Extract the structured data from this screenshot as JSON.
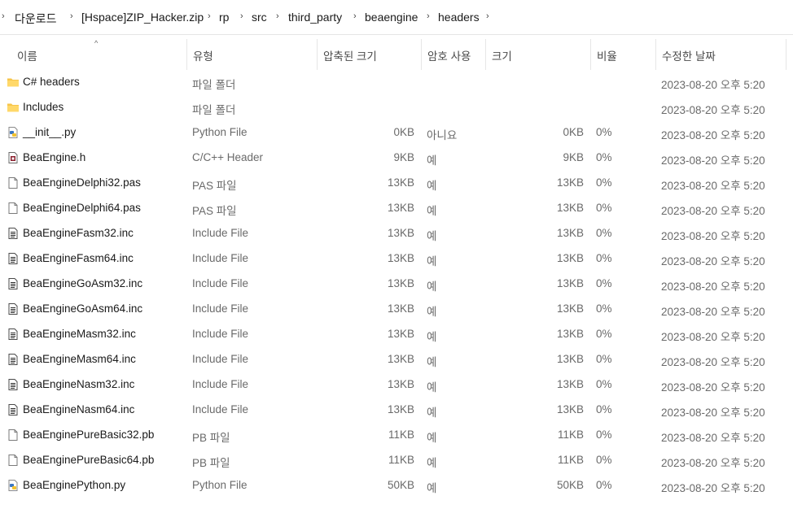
{
  "breadcrumb": {
    "lead_arrow": "›",
    "items": [
      "다운로드",
      "[Hspace]ZIP_Hacker.zip",
      "rp",
      "src",
      "third_party",
      "beaengine",
      "headers"
    ],
    "trail_arrow": "›"
  },
  "columns": {
    "name": "이름",
    "type": "유형",
    "compressed_size": "압축된 크기",
    "password": "암호 사용",
    "size": "크기",
    "ratio": "비율",
    "modified": "수정한 날짜",
    "sort_indicator": "^"
  },
  "rows": [
    {
      "icon": "folder-icon",
      "name": "C# headers",
      "type": "파일 폴더",
      "csize": "",
      "pw": "",
      "size": "",
      "ratio": "",
      "date": "2023-08-20 오후 5:20"
    },
    {
      "icon": "folder-icon",
      "name": "Includes",
      "type": "파일 폴더",
      "csize": "",
      "pw": "",
      "size": "",
      "ratio": "",
      "date": "2023-08-20 오후 5:20"
    },
    {
      "icon": "python-file-icon",
      "name": "__init__.py",
      "type": "Python File",
      "csize": "0KB",
      "pw": "아니요",
      "size": "0KB",
      "ratio": "0%",
      "date": "2023-08-20 오후 5:20"
    },
    {
      "icon": "header-file-icon",
      "name": "BeaEngine.h",
      "type": "C/C++ Header",
      "csize": "9KB",
      "pw": "예",
      "size": "9KB",
      "ratio": "0%",
      "date": "2023-08-20 오후 5:20"
    },
    {
      "icon": "blank-file-icon",
      "name": "BeaEngineDelphi32.pas",
      "type": "PAS 파일",
      "csize": "13KB",
      "pw": "예",
      "size": "13KB",
      "ratio": "0%",
      "date": "2023-08-20 오후 5:20"
    },
    {
      "icon": "blank-file-icon",
      "name": "BeaEngineDelphi64.pas",
      "type": "PAS 파일",
      "csize": "13KB",
      "pw": "예",
      "size": "13KB",
      "ratio": "0%",
      "date": "2023-08-20 오후 5:20"
    },
    {
      "icon": "text-file-icon",
      "name": "BeaEngineFasm32.inc",
      "type": "Include File",
      "csize": "13KB",
      "pw": "예",
      "size": "13KB",
      "ratio": "0%",
      "date": "2023-08-20 오후 5:20"
    },
    {
      "icon": "text-file-icon",
      "name": "BeaEngineFasm64.inc",
      "type": "Include File",
      "csize": "13KB",
      "pw": "예",
      "size": "13KB",
      "ratio": "0%",
      "date": "2023-08-20 오후 5:20"
    },
    {
      "icon": "text-file-icon",
      "name": "BeaEngineGoAsm32.inc",
      "type": "Include File",
      "csize": "13KB",
      "pw": "예",
      "size": "13KB",
      "ratio": "0%",
      "date": "2023-08-20 오후 5:20"
    },
    {
      "icon": "text-file-icon",
      "name": "BeaEngineGoAsm64.inc",
      "type": "Include File",
      "csize": "13KB",
      "pw": "예",
      "size": "13KB",
      "ratio": "0%",
      "date": "2023-08-20 오후 5:20"
    },
    {
      "icon": "text-file-icon",
      "name": "BeaEngineMasm32.inc",
      "type": "Include File",
      "csize": "13KB",
      "pw": "예",
      "size": "13KB",
      "ratio": "0%",
      "date": "2023-08-20 오후 5:20"
    },
    {
      "icon": "text-file-icon",
      "name": "BeaEngineMasm64.inc",
      "type": "Include File",
      "csize": "13KB",
      "pw": "예",
      "size": "13KB",
      "ratio": "0%",
      "date": "2023-08-20 오후 5:20"
    },
    {
      "icon": "text-file-icon",
      "name": "BeaEngineNasm32.inc",
      "type": "Include File",
      "csize": "13KB",
      "pw": "예",
      "size": "13KB",
      "ratio": "0%",
      "date": "2023-08-20 오후 5:20"
    },
    {
      "icon": "text-file-icon",
      "name": "BeaEngineNasm64.inc",
      "type": "Include File",
      "csize": "13KB",
      "pw": "예",
      "size": "13KB",
      "ratio": "0%",
      "date": "2023-08-20 오후 5:20"
    },
    {
      "icon": "blank-file-icon",
      "name": "BeaEnginePureBasic32.pb",
      "type": "PB 파일",
      "csize": "11KB",
      "pw": "예",
      "size": "11KB",
      "ratio": "0%",
      "date": "2023-08-20 오후 5:20"
    },
    {
      "icon": "blank-file-icon",
      "name": "BeaEnginePureBasic64.pb",
      "type": "PB 파일",
      "csize": "11KB",
      "pw": "예",
      "size": "11KB",
      "ratio": "0%",
      "date": "2023-08-20 오후 5:20"
    },
    {
      "icon": "python-file-icon",
      "name": "BeaEnginePython.py",
      "type": "Python File",
      "csize": "50KB",
      "pw": "예",
      "size": "50KB",
      "ratio": "0%",
      "date": "2023-08-20 오후 5:20"
    }
  ]
}
